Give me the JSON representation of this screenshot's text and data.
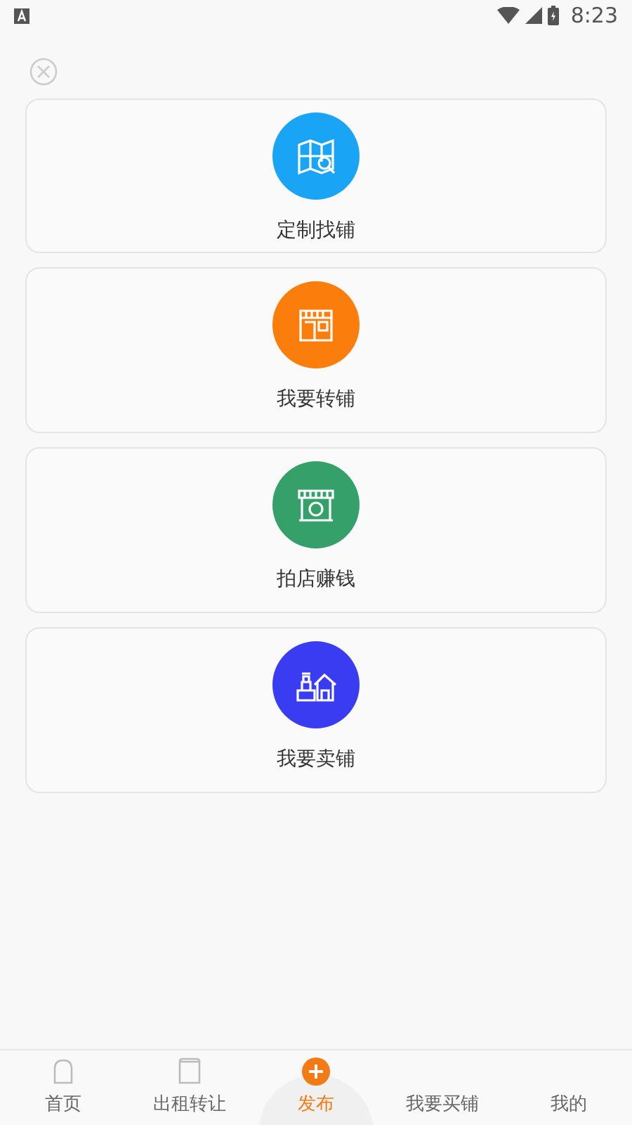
{
  "status_bar": {
    "time": "8:23"
  },
  "options": [
    {
      "kind": "map",
      "label": "定制找铺",
      "color": "#1aa4f5"
    },
    {
      "kind": "shop",
      "label": "我要转铺",
      "color": "#fb7d0b"
    },
    {
      "kind": "stall",
      "label": "拍店赚钱",
      "color": "#36a06a"
    },
    {
      "kind": "house",
      "label": "我要卖铺",
      "color": "#3a3cf2"
    }
  ],
  "tabs": [
    {
      "kind": "home",
      "label": "首页",
      "selected": false
    },
    {
      "kind": "doc",
      "label": "出租转让",
      "selected": false
    },
    {
      "kind": "publish",
      "label": "发布",
      "selected": true
    },
    {
      "kind": "buy",
      "label": "我要买铺",
      "selected": false
    },
    {
      "kind": "me",
      "label": "我的",
      "selected": false
    }
  ]
}
